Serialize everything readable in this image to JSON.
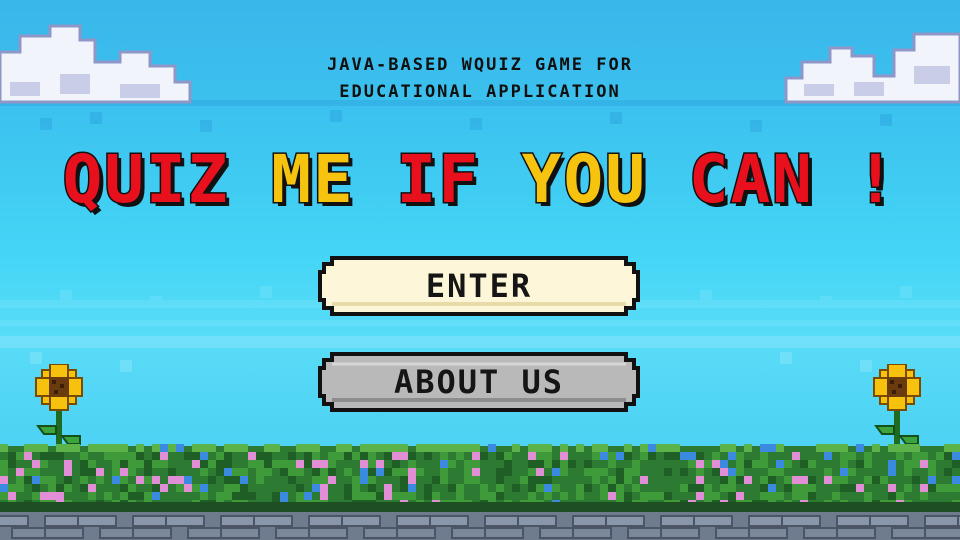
{
  "header": {
    "subtitle_line1": "JAVA-BASED WQUIZ GAME FOR",
    "subtitle_line2": "EDUCATIONAL APPLICATION"
  },
  "title": {
    "words": [
      {
        "text": "QUIZ",
        "color": "#e8101c"
      },
      {
        "text": "ME",
        "color": "#f6c40e"
      },
      {
        "text": "IF",
        "color": "#e8101c"
      },
      {
        "text": "YOU",
        "color": "#f6c40e"
      },
      {
        "text": "CAN",
        "color": "#e8101c"
      },
      {
        "text": "!",
        "color": "#e8101c"
      }
    ]
  },
  "buttons": {
    "enter_label": "ENTER",
    "about_label": "ABOUT US"
  },
  "colors": {
    "sky": "#3cc3ef",
    "enter_fill": "#fdf6d8",
    "about_fill": "#b8b8b8",
    "grass": "#2f7a2f",
    "stone": "#6e7a8c"
  },
  "decorations": {
    "left_flower": "sunflower-icon",
    "right_flower": "sunflower-icon",
    "clouds": "cloud-icon"
  }
}
